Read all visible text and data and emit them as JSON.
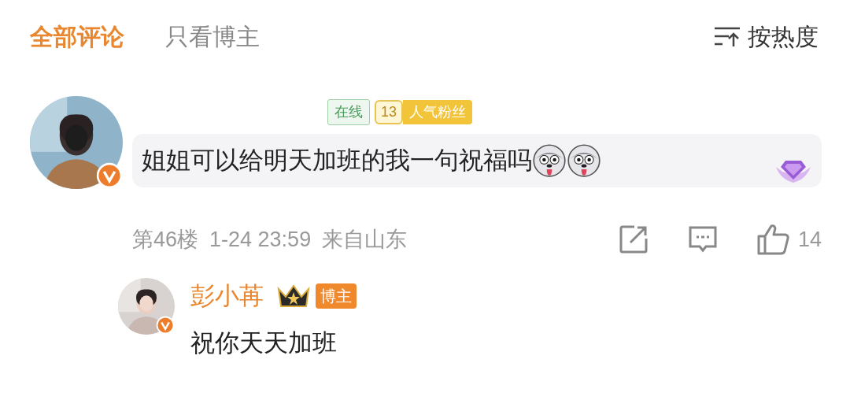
{
  "tabs": [
    {
      "label": "全部评论",
      "selected": true
    },
    {
      "label": "只看博主",
      "selected": false
    }
  ],
  "sort": {
    "label": "按热度"
  },
  "comment": {
    "avatar": {
      "kind": "picture",
      "verified": true
    },
    "badges": [
      {
        "kind": "status",
        "label": "在线"
      },
      {
        "kind": "fan",
        "level": "13",
        "label": "人气粉丝"
      }
    ],
    "text": "姐姐可以给明天加班的我一句祝福吗",
    "emojis": [
      {
        "kind": "husky"
      },
      {
        "kind": "husky"
      }
    ],
    "floor": "第46楼",
    "date": "1-24 23:59",
    "location": "来自山东",
    "likes": "14",
    "reply": {
      "avatar": {
        "kind": "picture",
        "verified": true
      },
      "name": "彭小苒",
      "badge": "博主",
      "text": "祝你天天加班"
    }
  }
}
